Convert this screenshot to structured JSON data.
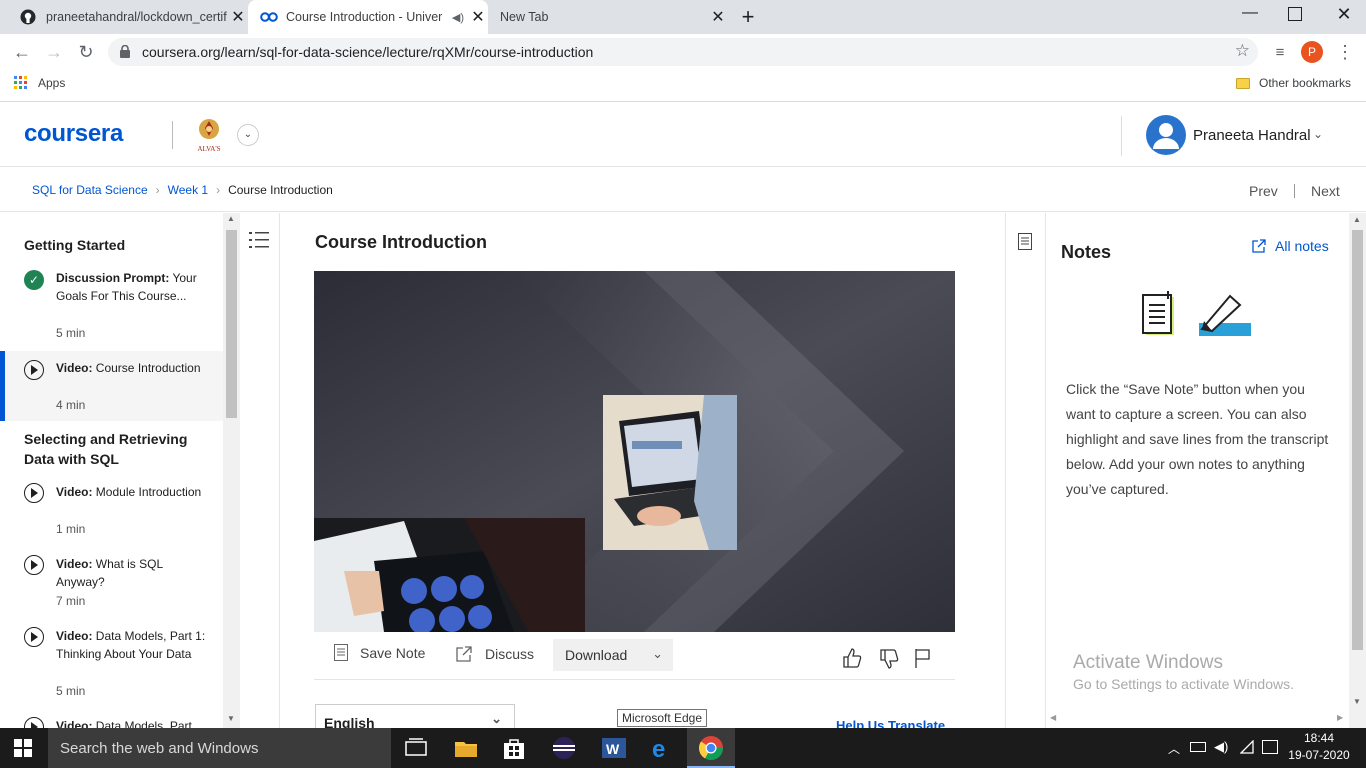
{
  "browser": {
    "tabs": [
      {
        "title": "praneetahandral/lockdown_certif"
      },
      {
        "title": "Course Introduction - Univer"
      },
      {
        "title": "New Tab"
      }
    ],
    "url": "coursera.org/learn/sql-for-data-science/lecture/rqXMr/course-introduction",
    "profile_initial": "P",
    "bookmarks": {
      "apps": "Apps",
      "other": "Other bookmarks"
    }
  },
  "header": {
    "logo": "coursera",
    "partner_logo_text": "ALVA'S",
    "user_name": "Praneeta Handral"
  },
  "breadcrumb": {
    "items": [
      "SQL for Data Science",
      "Week 1",
      "Course Introduction"
    ],
    "prev": "Prev",
    "next": "Next"
  },
  "sidebar": {
    "sections": [
      {
        "title": "Getting Started"
      },
      {
        "title": "Selecting and Retrieving Data with SQL"
      }
    ],
    "items": [
      {
        "type": "Discussion Prompt:",
        "title": "Your Goals For This Course...",
        "duration": "5 min"
      },
      {
        "type": "Video:",
        "title": "Course Introduction",
        "duration": "4 min"
      },
      {
        "type": "Video:",
        "title": "Module Introduction",
        "duration": "1 min"
      },
      {
        "type": "Video:",
        "title": "What is SQL Anyway?",
        "duration": "7 min"
      },
      {
        "type": "Video:",
        "title": "Data Models, Part 1: Thinking About Your Data",
        "duration": "5 min"
      },
      {
        "type": "Video:",
        "title": "Data Models, Part",
        "duration": ""
      }
    ]
  },
  "main": {
    "title": "Course Introduction",
    "actions": {
      "save_note": "Save Note",
      "discuss": "Discuss",
      "download": "Download"
    },
    "language": "English",
    "help_translate": "Help Us Translate",
    "tooltip": "Microsoft Edge"
  },
  "notes": {
    "title": "Notes",
    "all_notes": "All notes",
    "description": "Click the “Save Note” button when you want to capture a screen. You can also highlight and save lines from the transcript below. Add your own notes to anything you’ve captured."
  },
  "watermark": {
    "line1": "Activate Windows",
    "line2": "Go to Settings to activate Windows."
  },
  "taskbar": {
    "search_placeholder": "Search the web and Windows",
    "time": "18:44",
    "date": "19-07-2020"
  },
  "colors": {
    "accent": "#0056d2",
    "active_marker": "#0056d2",
    "complete": "#1f8354"
  }
}
